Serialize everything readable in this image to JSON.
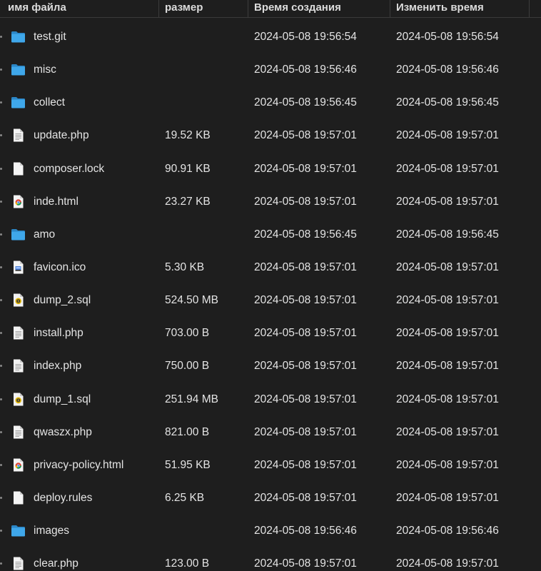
{
  "columns": {
    "name": "имя файла",
    "size": "размер",
    "created": "Время создания",
    "modified": "Изменить время"
  },
  "colors": {
    "background": "#1e1e1e",
    "text": "#e4e4e4",
    "folder": "#3a9fe0",
    "folder_dark": "#2b86c6",
    "document": "#f2f2f2"
  },
  "files": [
    {
      "name": "test.git",
      "size": "",
      "created": "2024-05-08 19:56:54",
      "modified": "2024-05-08 19:56:54",
      "icon": "folder-icon"
    },
    {
      "name": "misc",
      "size": "",
      "created": "2024-05-08 19:56:46",
      "modified": "2024-05-08 19:56:46",
      "icon": "folder-icon"
    },
    {
      "name": "collect",
      "size": "",
      "created": "2024-05-08 19:56:45",
      "modified": "2024-05-08 19:56:45",
      "icon": "folder-icon"
    },
    {
      "name": "update.php",
      "size": "19.52 KB",
      "created": "2024-05-08 19:57:01",
      "modified": "2024-05-08 19:57:01",
      "icon": "text-file-icon"
    },
    {
      "name": "composer.lock",
      "size": "90.91 KB",
      "created": "2024-05-08 19:57:01",
      "modified": "2024-05-08 19:57:01",
      "icon": "blank-file-icon"
    },
    {
      "name": "inde.html",
      "size": "23.27 KB",
      "created": "2024-05-08 19:57:01",
      "modified": "2024-05-08 19:57:01",
      "icon": "chrome-html-file-icon"
    },
    {
      "name": "amo",
      "size": "",
      "created": "2024-05-08 19:56:45",
      "modified": "2024-05-08 19:56:45",
      "icon": "folder-icon"
    },
    {
      "name": "favicon.ico",
      "size": "5.30 KB",
      "created": "2024-05-08 19:57:01",
      "modified": "2024-05-08 19:57:01",
      "icon": "image-file-icon"
    },
    {
      "name": "dump_2.sql",
      "size": "524.50 MB",
      "created": "2024-05-08 19:57:01",
      "modified": "2024-05-08 19:57:01",
      "icon": "sql-file-icon"
    },
    {
      "name": "install.php",
      "size": "703.00 B",
      "created": "2024-05-08 19:57:01",
      "modified": "2024-05-08 19:57:01",
      "icon": "text-file-icon"
    },
    {
      "name": "index.php",
      "size": "750.00 B",
      "created": "2024-05-08 19:57:01",
      "modified": "2024-05-08 19:57:01",
      "icon": "text-file-icon"
    },
    {
      "name": "dump_1.sql",
      "size": "251.94 MB",
      "created": "2024-05-08 19:57:01",
      "modified": "2024-05-08 19:57:01",
      "icon": "sql-file-icon"
    },
    {
      "name": "qwaszx.php",
      "size": "821.00 B",
      "created": "2024-05-08 19:57:01",
      "modified": "2024-05-08 19:57:01",
      "icon": "text-file-icon"
    },
    {
      "name": "privacy-policy.html",
      "size": "51.95 KB",
      "created": "2024-05-08 19:57:01",
      "modified": "2024-05-08 19:57:01",
      "icon": "chrome-html-file-icon"
    },
    {
      "name": "deploy.rules",
      "size": "6.25 KB",
      "created": "2024-05-08 19:57:01",
      "modified": "2024-05-08 19:57:01",
      "icon": "blank-file-icon"
    },
    {
      "name": "images",
      "size": "",
      "created": "2024-05-08 19:56:46",
      "modified": "2024-05-08 19:56:46",
      "icon": "folder-icon"
    },
    {
      "name": "clear.php",
      "size": "123.00 B",
      "created": "2024-05-08 19:57:01",
      "modified": "2024-05-08 19:57:01",
      "icon": "text-file-icon"
    }
  ]
}
